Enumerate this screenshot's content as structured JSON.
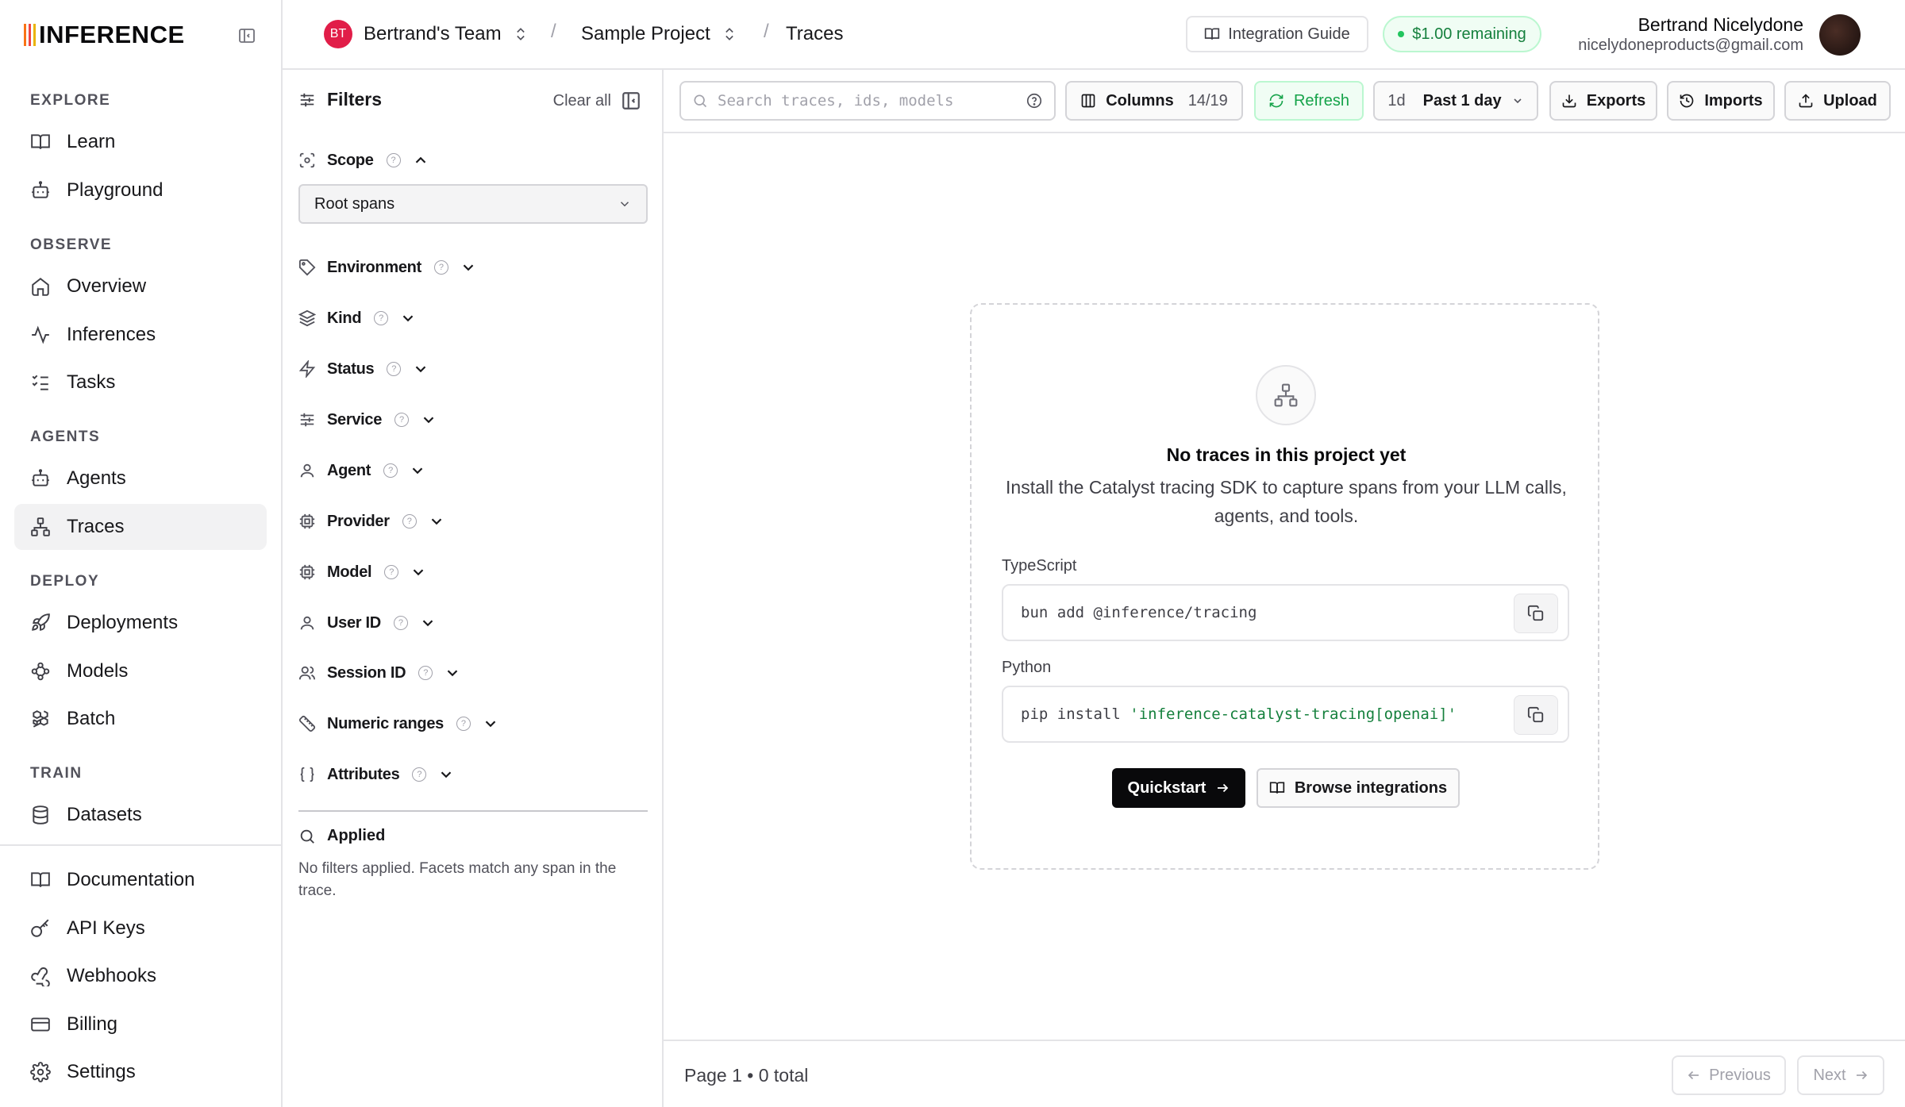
{
  "app": {
    "logo_text": "INFERENCE",
    "logo_colors": [
      "#f97316",
      "#ef4444",
      "#eab308"
    ]
  },
  "sidebar": {
    "sections": [
      {
        "title": "EXPLORE",
        "items": [
          {
            "label": "Learn",
            "icon": "book-icon"
          },
          {
            "label": "Playground",
            "icon": "bot-icon"
          }
        ]
      },
      {
        "title": "OBSERVE",
        "items": [
          {
            "label": "Overview",
            "icon": "home-icon"
          },
          {
            "label": "Inferences",
            "icon": "activity-icon"
          },
          {
            "label": "Tasks",
            "icon": "list-checks-icon"
          }
        ]
      },
      {
        "title": "AGENTS",
        "items": [
          {
            "label": "Agents",
            "icon": "bot-icon"
          },
          {
            "label": "Traces",
            "icon": "network-icon",
            "active": true
          }
        ]
      },
      {
        "title": "DEPLOY",
        "items": [
          {
            "label": "Deployments",
            "icon": "rocket-icon"
          },
          {
            "label": "Models",
            "icon": "models-icon"
          },
          {
            "label": "Batch",
            "icon": "boxes-icon"
          }
        ]
      },
      {
        "title": "TRAIN",
        "items": [
          {
            "label": "Datasets",
            "icon": "database-icon"
          }
        ]
      }
    ],
    "bottom_items": [
      {
        "label": "Documentation",
        "icon": "book-icon"
      },
      {
        "label": "API Keys",
        "icon": "key-icon"
      },
      {
        "label": "Webhooks",
        "icon": "webhook-icon"
      },
      {
        "label": "Billing",
        "icon": "credit-card-icon"
      },
      {
        "label": "Settings",
        "icon": "gear-icon"
      }
    ]
  },
  "header": {
    "team_initials": "BT",
    "team_name": "Bertrand's Team",
    "project_name": "Sample Project",
    "page": "Traces",
    "separator": "/",
    "integration_guide": "Integration Guide",
    "credits": "$1.00 remaining",
    "user_name": "Bertrand Nicelydone",
    "user_email": "nicelydoneproducts@gmail.com"
  },
  "filters": {
    "title": "Filters",
    "clear_all": "Clear all",
    "scope": {
      "label": "Scope",
      "value": "Root spans",
      "expanded": true
    },
    "facets": [
      {
        "label": "Environment",
        "icon": "tag-icon"
      },
      {
        "label": "Kind",
        "icon": "layers-icon"
      },
      {
        "label": "Status",
        "icon": "zap-icon"
      },
      {
        "label": "Service",
        "icon": "sliders-icon"
      },
      {
        "label": "Agent",
        "icon": "user-icon"
      },
      {
        "label": "Provider",
        "icon": "cpu-icon"
      },
      {
        "label": "Model",
        "icon": "cpu-icon"
      },
      {
        "label": "User ID",
        "icon": "user-icon"
      },
      {
        "label": "Session ID",
        "icon": "users-icon"
      },
      {
        "label": "Numeric ranges",
        "icon": "ruler-icon"
      },
      {
        "label": "Attributes",
        "icon": "braces-icon"
      }
    ],
    "applied_title": "Applied",
    "applied_text": "No filters applied. Facets match any span in the trace."
  },
  "toolbar": {
    "search_placeholder": "Search traces, ids, models",
    "columns_label": "Columns",
    "columns_count": "14/19",
    "refresh": "Refresh",
    "range_short": "1d",
    "range_label": "Past 1 day",
    "exports": "Exports",
    "imports": "Imports",
    "upload": "Upload"
  },
  "empty_state": {
    "title": "No traces in this project yet",
    "description": "Install the Catalyst tracing SDK to capture spans from your LLM calls, agents, and tools.",
    "ts_label": "TypeScript",
    "ts_command": "bun add @inference/tracing",
    "py_label": "Python",
    "py_command_prefix": "pip install ",
    "py_command_arg": "'inference-catalyst-tracing[openai]'",
    "quickstart": "Quickstart",
    "browse": "Browse integrations"
  },
  "footer": {
    "page_info": "Page 1 • 0 total",
    "previous": "Previous",
    "next": "Next"
  }
}
